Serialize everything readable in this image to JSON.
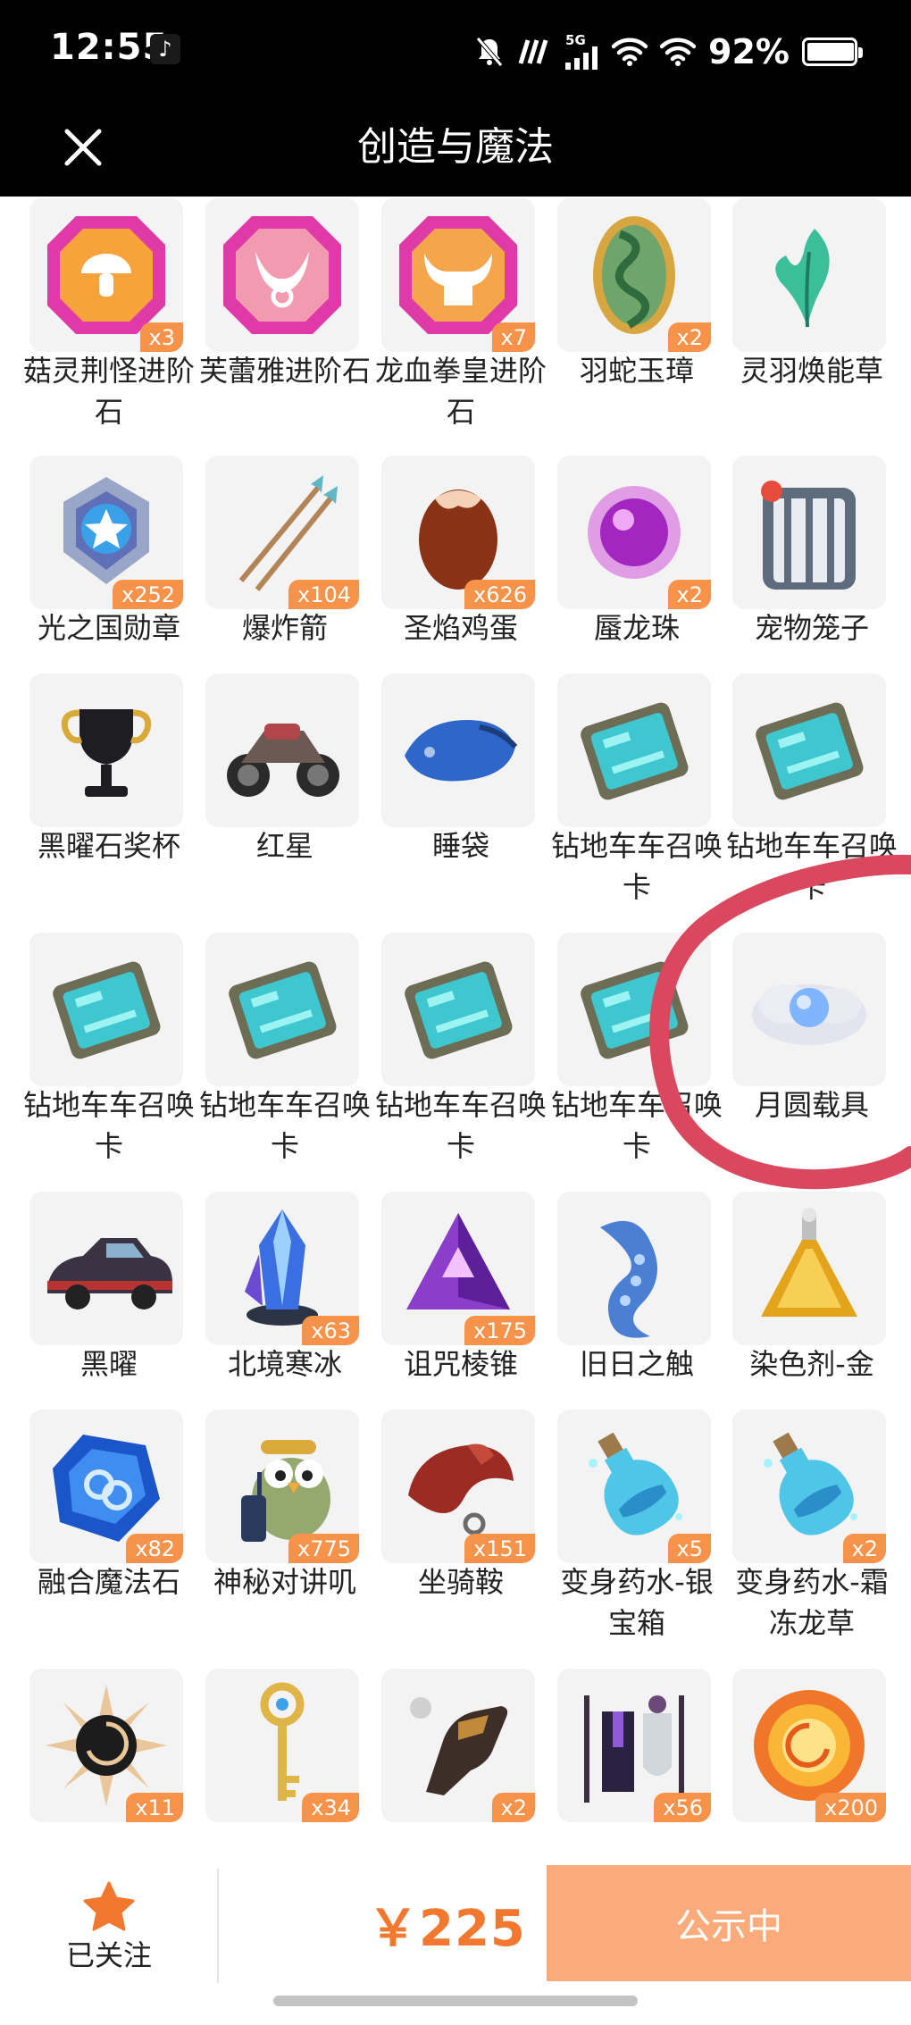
{
  "status_bar": {
    "time": "12:55",
    "network": "5G",
    "battery_percent": "92%",
    "battery_level": 0.92
  },
  "header": {
    "title": "创造与魔法"
  },
  "items": [
    {
      "name": "菇灵荆怪进阶石",
      "badge": "x3",
      "icon": "mushroom-gem-icon"
    },
    {
      "name": "芙蕾雅进阶石",
      "badge": "",
      "icon": "horns-gem-icon"
    },
    {
      "name": "龙血拳皇进阶石",
      "badge": "x7",
      "icon": "bull-gem-icon"
    },
    {
      "name": "羽蛇玉璋",
      "badge": "x2",
      "icon": "serpent-jade-icon"
    },
    {
      "name": "灵羽焕能草",
      "badge": "",
      "icon": "feather-grass-icon"
    },
    {
      "name": "光之国勋章",
      "badge": "x252",
      "icon": "star-medal-icon"
    },
    {
      "name": "爆炸箭",
      "badge": "x104",
      "icon": "arrows-icon"
    },
    {
      "name": "圣焰鸡蛋",
      "badge": "x626",
      "icon": "egg-icon"
    },
    {
      "name": "蜃龙珠",
      "badge": "x2",
      "icon": "purple-orb-icon"
    },
    {
      "name": "宠物笼子",
      "badge": "",
      "icon": "pet-cage-icon"
    },
    {
      "name": "黑曜石奖杯",
      "badge": "",
      "icon": "trophy-icon"
    },
    {
      "name": "红星",
      "badge": "",
      "icon": "motorcycle-icon"
    },
    {
      "name": "睡袋",
      "badge": "",
      "icon": "sleeping-bag-icon"
    },
    {
      "name": "钻地车车召唤卡",
      "badge": "",
      "icon": "summon-card-icon"
    },
    {
      "name": "钻地车车召唤卡",
      "badge": "",
      "icon": "summon-card-icon"
    },
    {
      "name": "钻地车车召唤卡",
      "badge": "",
      "icon": "summon-card-icon"
    },
    {
      "name": "钻地车车召唤卡",
      "badge": "",
      "icon": "summon-card-icon"
    },
    {
      "name": "钻地车车召唤卡",
      "badge": "",
      "icon": "summon-card-icon"
    },
    {
      "name": "钻地车车召唤卡",
      "badge": "",
      "icon": "summon-card-icon"
    },
    {
      "name": "月圆载具",
      "badge": "",
      "icon": "moon-cloud-icon"
    },
    {
      "name": "黑曜",
      "badge": "",
      "icon": "car-icon"
    },
    {
      "name": "北境寒冰",
      "badge": "x63",
      "icon": "ice-crystal-icon"
    },
    {
      "name": "诅咒棱锥",
      "badge": "x175",
      "icon": "pyramid-icon"
    },
    {
      "name": "旧日之触",
      "badge": "",
      "icon": "tentacle-icon"
    },
    {
      "name": "染色剂-金",
      "badge": "",
      "icon": "gold-flask-icon"
    },
    {
      "name": "融合魔法石",
      "badge": "x82",
      "icon": "magic-stone-icon"
    },
    {
      "name": "神秘对讲叽",
      "badge": "x775",
      "icon": "walkie-bird-icon"
    },
    {
      "name": "坐骑鞍",
      "badge": "x151",
      "icon": "saddle-icon"
    },
    {
      "name": "变身药水-银宝箱",
      "badge": "x5",
      "icon": "potion-icon"
    },
    {
      "name": "变身药水-霜冻龙草",
      "badge": "x2",
      "icon": "potion-icon"
    },
    {
      "name": "",
      "badge": "x11",
      "icon": "dark-sun-icon"
    },
    {
      "name": "",
      "badge": "x34",
      "icon": "golden-key-icon"
    },
    {
      "name": "",
      "badge": "x2",
      "icon": "gauntlet-icon"
    },
    {
      "name": "",
      "badge": "x56",
      "icon": "costume-rack-icon"
    },
    {
      "name": "",
      "badge": "x200",
      "icon": "fire-coin-icon"
    }
  ],
  "bottom_bar": {
    "follow_label": "已关注",
    "price": "￥225",
    "status_label": "公示中"
  },
  "colors": {
    "accent": "#f2772f",
    "badge": "#f7924a",
    "status_button": "#fbab7a",
    "annotation": "#d9485f",
    "header": "#000000"
  }
}
